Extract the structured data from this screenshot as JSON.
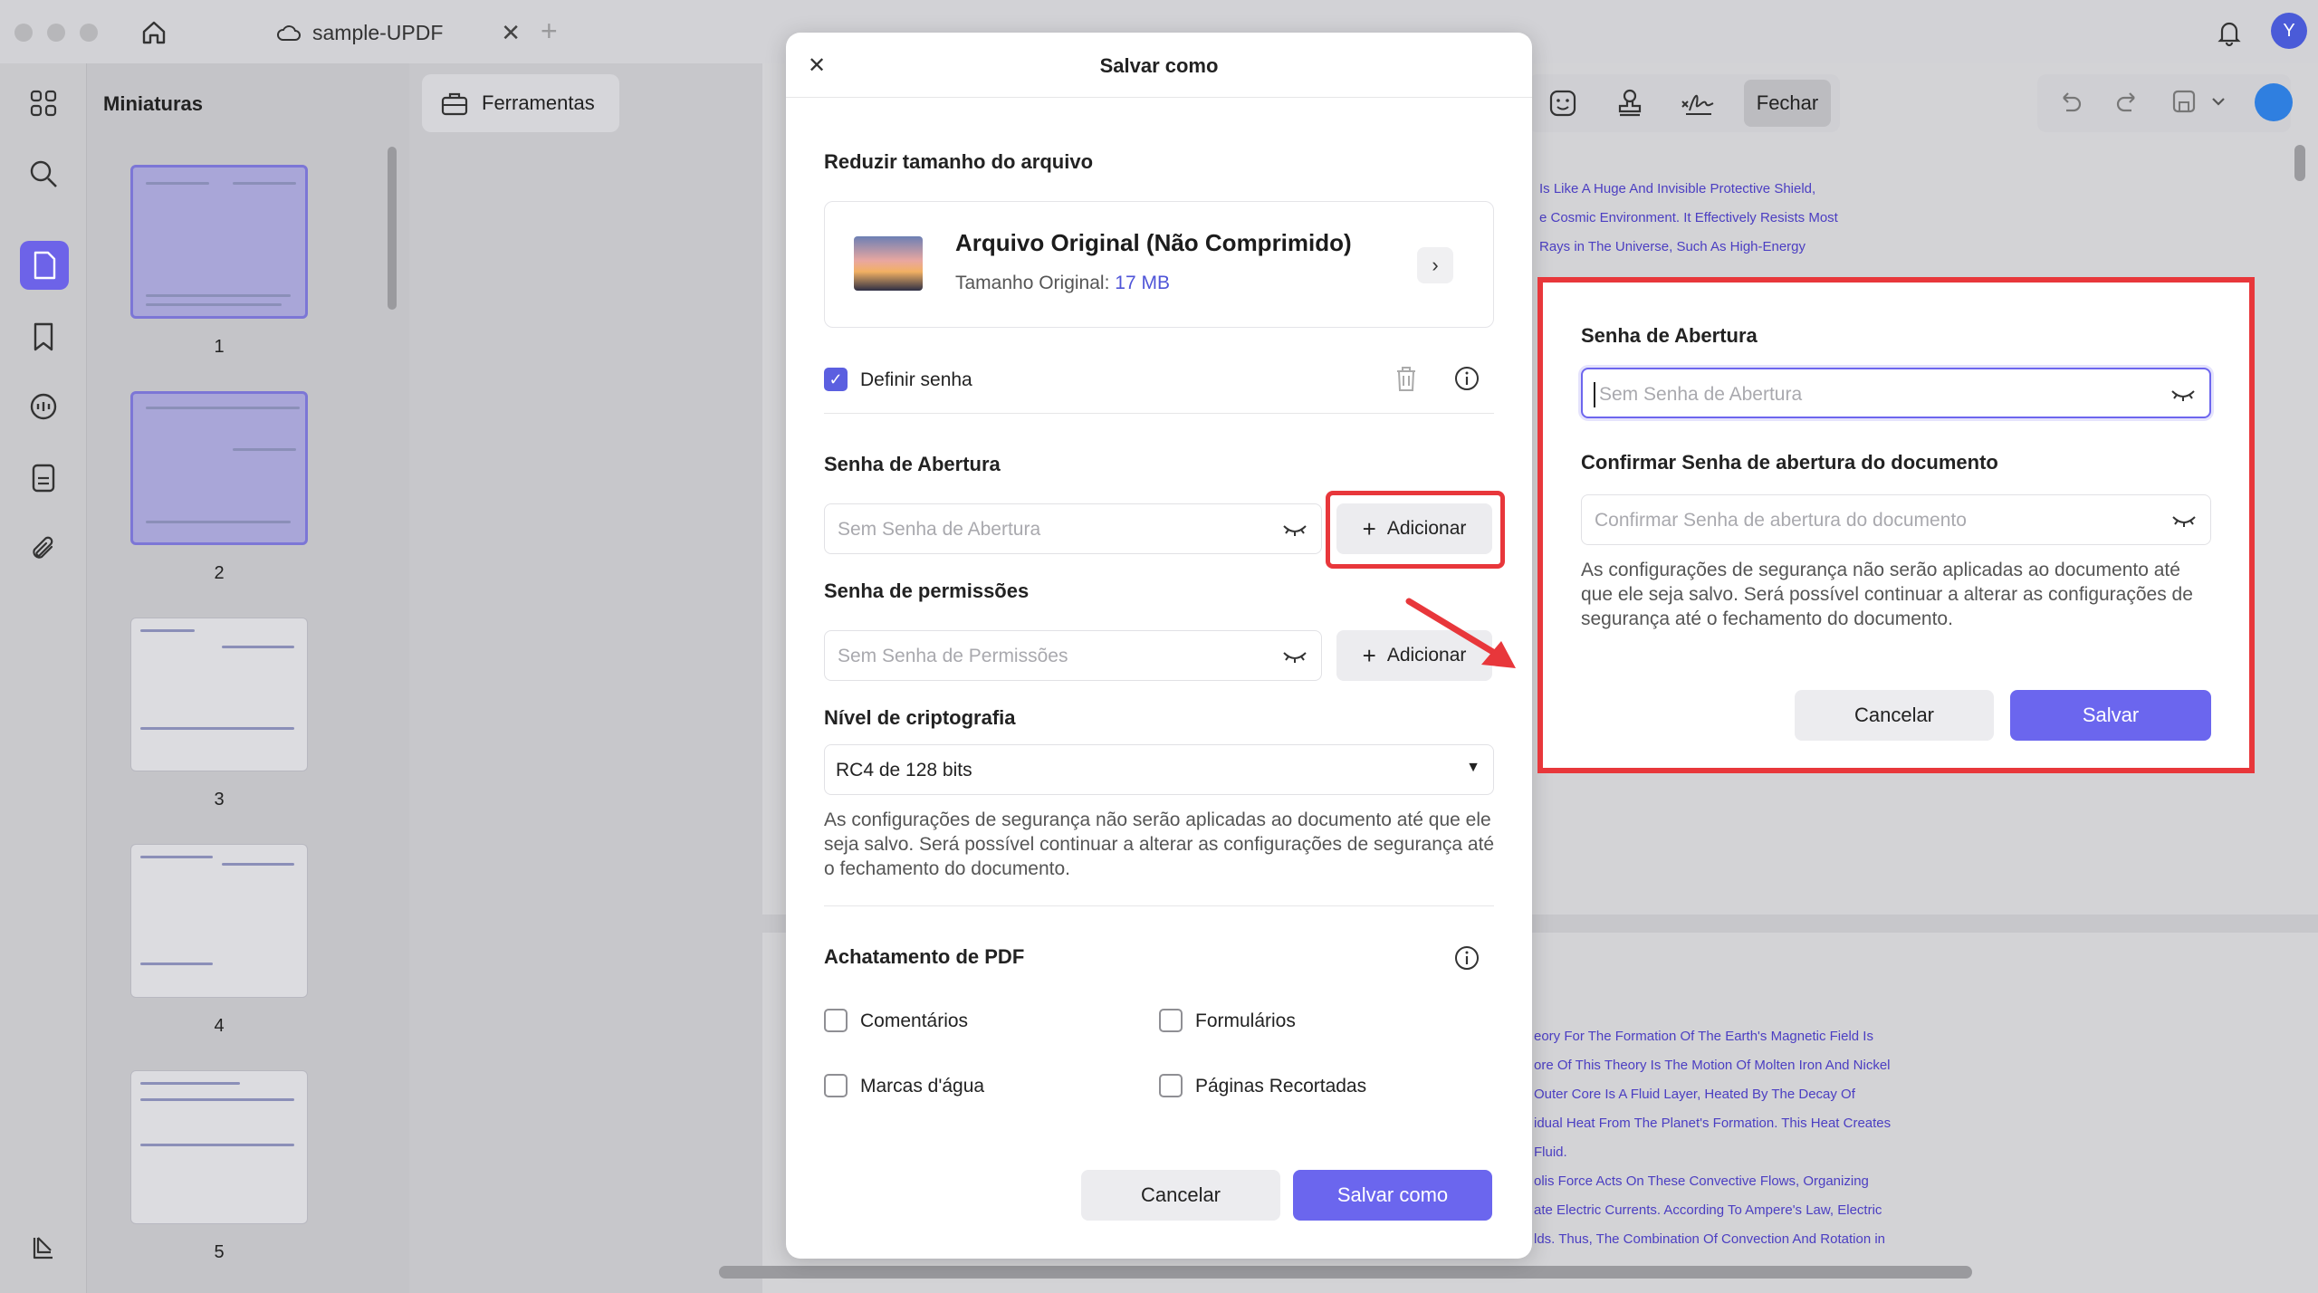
{
  "app": {
    "tab_title": "sample-UPDF",
    "avatar_initial": "Y"
  },
  "thumbnails": {
    "title": "Miniaturas",
    "pages": [
      "1",
      "2",
      "3",
      "4",
      "5"
    ]
  },
  "toolbar": {
    "tools_label": "Ferramentas",
    "close_label": "Fechar"
  },
  "document": {
    "lines_top": [
      "Is Like A Huge And Invisible Protective Shield,",
      "e Cosmic Environment. It Effectively Resists Most",
      "Rays in The Universe, Such As High-Energy"
    ],
    "lines_bottom": [
      "eory For The Formation Of The Earth's Magnetic Field Is",
      "ore Of This Theory Is The Motion Of Molten Iron And Nickel",
      "Outer Core Is A Fluid Layer, Heated By The Decay Of",
      "idual Heat From The Planet's Formation. This Heat Creates",
      "Fluid.",
      "olis Force Acts On These Convective Flows, Organizing",
      "ate Electric Currents. According To Ampere's Law, Electric",
      "lds. Thus, The Combination Of Convection And Rotation in"
    ]
  },
  "dialog": {
    "title": "Salvar como",
    "reduce_title": "Reduzir tamanho do arquivo",
    "file_name": "Arquivo Original (Não Comprimido)",
    "file_size_label": "Tamanho Original: ",
    "file_size_value": "17 MB",
    "set_password_label": "Definir senha",
    "set_password_checked": true,
    "open_password_title": "Senha de Abertura",
    "open_password_placeholder": "Sem Senha de Abertura",
    "add_label": "Adicionar",
    "permissions_title": "Senha de permissões",
    "permissions_placeholder": "Sem Senha de Permissões",
    "encryption_title": "Nível de criptografia",
    "encryption_value": "RC4 de 128 bits",
    "security_note": "As configurações de segurança não serão aplicadas ao documento até que ele seja salvo. Será possível continuar a alterar as configurações de segurança até o fechamento do documento.",
    "flatten_title": "Achatamento de PDF",
    "flatten_options": [
      "Comentários",
      "Formulários",
      "Marcas d'água",
      "Páginas Recortadas"
    ],
    "cancel_label": "Cancelar",
    "save_as_label": "Salvar como"
  },
  "callout": {
    "open_password_title": "Senha de Abertura",
    "open_password_placeholder": "Sem Senha de Abertura",
    "confirm_title": "Confirmar Senha de abertura do documento",
    "confirm_placeholder": "Confirmar Senha de abertura do documento",
    "note": "As configurações de segurança não serão aplicadas ao documento até que ele seja salvo. Será possível continuar a alterar as configurações de segurança até o fechamento do documento.",
    "cancel_label": "Cancelar",
    "save_label": "Salvar"
  },
  "colors": {
    "accent": "#6b66ee",
    "highlight": "#e8373b",
    "link_size": "#4f55d8"
  }
}
